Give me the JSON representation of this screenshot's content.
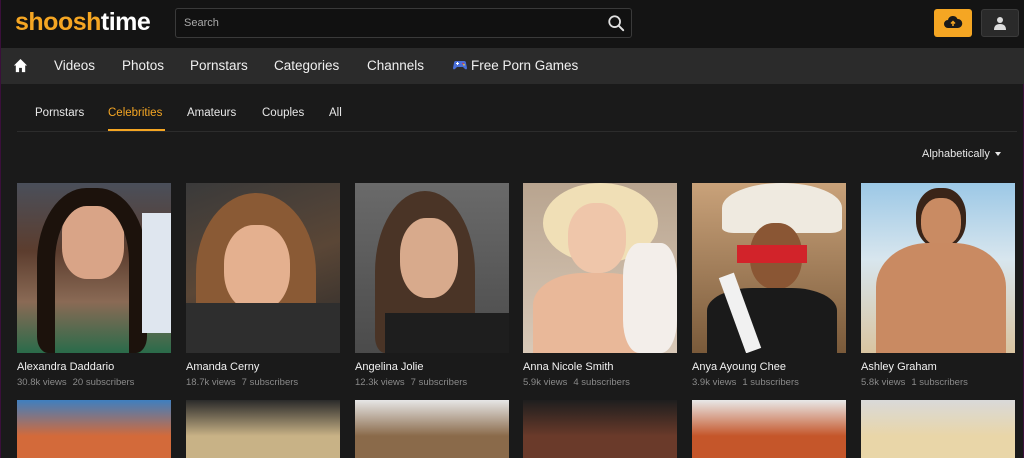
{
  "logo": {
    "part1": "shoosh",
    "part2": "time"
  },
  "search": {
    "placeholder": "Search"
  },
  "nav": {
    "items": [
      "Videos",
      "Photos",
      "Pornstars",
      "Categories",
      "Channels"
    ],
    "games_label": "Free Porn Games"
  },
  "subnav": {
    "items": [
      "Pornstars",
      "Celebrities",
      "Amateurs",
      "Couples",
      "All"
    ],
    "active": "Celebrities"
  },
  "sort": {
    "label": "Alphabetically"
  },
  "colors": {
    "accent": "#f5a623",
    "background": "#1a1a1a",
    "navbar": "#2b2b2b"
  },
  "icons": {
    "home": "home-icon",
    "search": "search-icon",
    "upload": "upload-icon",
    "user": "user-icon",
    "games": "game-controller-icon"
  },
  "celebrities": [
    {
      "name": "Alexandra Daddario",
      "views": "30.8k views",
      "subscribers": "20 subscribers"
    },
    {
      "name": "Amanda Cerny",
      "views": "18.7k views",
      "subscribers": "7 subscribers"
    },
    {
      "name": "Angelina Jolie",
      "views": "12.3k views",
      "subscribers": "7 subscribers"
    },
    {
      "name": "Anna Nicole Smith",
      "views": "5.9k views",
      "subscribers": "4 subscribers"
    },
    {
      "name": "Anya Ayoung Chee",
      "views": "3.9k views",
      "subscribers": "1 subscribers"
    },
    {
      "name": "Ashley Graham",
      "views": "5.8k views",
      "subscribers": "1 subscribers"
    }
  ]
}
